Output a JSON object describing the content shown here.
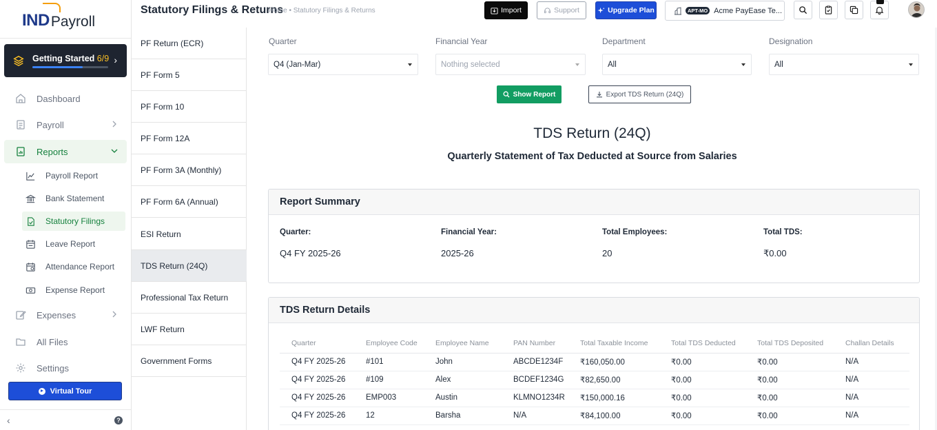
{
  "brand": {
    "logo_primary": "IND",
    "logo_secondary": "Payroll"
  },
  "sidebar": {
    "getting_started": {
      "label": "Getting Started",
      "count": "6/9",
      "progress": 0.667
    },
    "nav": [
      {
        "label": "Dashboard",
        "icon": "home-icon"
      },
      {
        "label": "Payroll",
        "icon": "document-icon"
      },
      {
        "label": "Reports",
        "icon": "report-icon"
      },
      {
        "label": "Expenses",
        "icon": "edit-icon"
      },
      {
        "label": "All Files",
        "icon": "folder-icon"
      },
      {
        "label": "Settings",
        "icon": "gear-icon"
      }
    ],
    "reports_sub": [
      {
        "label": "Payroll Report",
        "icon": "line-chart-icon"
      },
      {
        "label": "Bank Statement",
        "icon": "bank-icon"
      },
      {
        "label": "Statutory Filings",
        "icon": "file-check-icon"
      },
      {
        "label": "Leave Report",
        "icon": "calendar-icon"
      },
      {
        "label": "Attendance Report",
        "icon": "calendar-clock-icon"
      },
      {
        "label": "Expense Report",
        "icon": "money-icon"
      }
    ],
    "virtual_tour": "Virtual Tour"
  },
  "header": {
    "title": "Statutory Filings & Returns",
    "breadcrumb": "Home • Statutory Filings & Returns",
    "import_label": "Import",
    "support_label": "Support",
    "upgrade_label": "Upgrade Plan",
    "company_badge": "APT-MO",
    "company_name": "Acme PayEase Te..."
  },
  "forms": [
    "PF Return (ECR)",
    "PF Form 5",
    "PF Form 10",
    "PF Form 12A",
    "PF Form 3A (Monthly)",
    "PF Form 6A (Annual)",
    "ESI Return",
    "TDS Return (24Q)",
    "Professional Tax Return",
    "LWF Return",
    "Government Forms"
  ],
  "active_form": "TDS Return (24Q)",
  "filters": {
    "quarter": {
      "label": "Quarter",
      "value": "Q4 (Jan-Mar)"
    },
    "financial_year": {
      "label": "Financial Year",
      "placeholder": "Nothing selected"
    },
    "department": {
      "label": "Department",
      "value": "All"
    },
    "designation": {
      "label": "Designation",
      "value": "All"
    }
  },
  "actions": {
    "show_report": "Show Report",
    "export": "Export TDS Return (24Q)"
  },
  "report": {
    "title": "TDS Return (24Q)",
    "subtitle": "Quarterly Statement of Tax Deducted at Source from Salaries",
    "summary": {
      "heading": "Report Summary",
      "items": [
        {
          "label": "Quarter:",
          "value": "Q4 FY 2025-26"
        },
        {
          "label": "Financial Year:",
          "value": "2025-26"
        },
        {
          "label": "Total Employees:",
          "value": "20"
        },
        {
          "label": "Total TDS:",
          "value": "₹0.00"
        }
      ]
    },
    "details": {
      "heading": "TDS Return Details",
      "columns": [
        "Quarter",
        "Employee Code",
        "Employee Name",
        "PAN Number",
        "Total Taxable Income",
        "Total TDS Deducted",
        "Total TDS Deposited",
        "Challan Details"
      ],
      "rows": [
        [
          "Q4 FY 2025-26",
          "#101",
          "John",
          "ABCDE1234F",
          "₹160,050.00",
          "₹0.00",
          "₹0.00",
          "N/A"
        ],
        [
          "Q4 FY 2025-26",
          "#109",
          "Alex",
          "BCDEF1234G",
          "₹82,650.00",
          "₹0.00",
          "₹0.00",
          "N/A"
        ],
        [
          "Q4 FY 2025-26",
          "EMP003",
          "Austin",
          "KLMNO1234R",
          "₹150,000.16",
          "₹0.00",
          "₹0.00",
          "N/A"
        ],
        [
          "Q4 FY 2025-26",
          "12",
          "Barsha",
          "N/A",
          "₹84,100.00",
          "₹0.00",
          "₹0.00",
          "N/A"
        ]
      ]
    }
  },
  "colors": {
    "accent_green": "#129d62",
    "brand_blue": "#1d4ed8",
    "sidebar_dark": "#1e2430",
    "active_green": "#15803d"
  }
}
